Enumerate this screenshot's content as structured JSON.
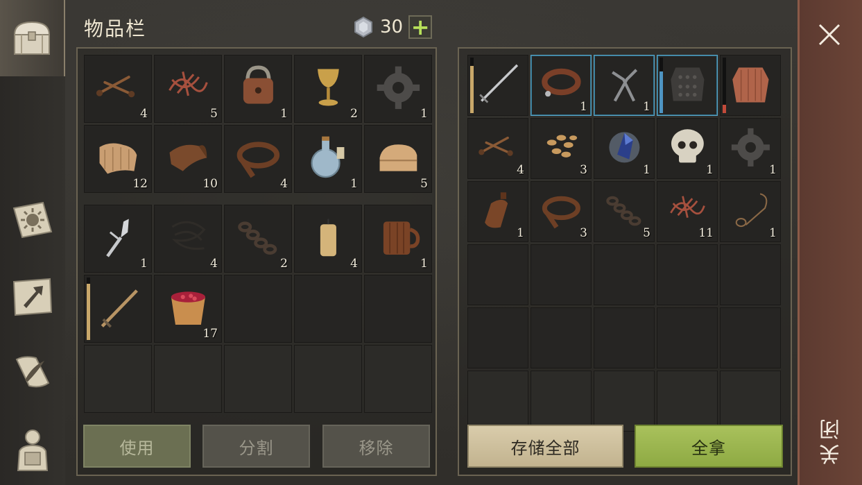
{
  "header": {
    "title": "物品栏",
    "currency_count": "30",
    "add_button_label": "+"
  },
  "sidebar": {
    "tabs": [
      {
        "name": "chest-icon",
        "active": true
      },
      {
        "name": "sun-map-icon",
        "active": false
      },
      {
        "name": "build-hammer-icon",
        "active": false
      },
      {
        "name": "quill-scroll-icon",
        "active": false
      },
      {
        "name": "character-backpack-icon",
        "active": false
      }
    ]
  },
  "inventory": {
    "top_grid": [
      {
        "item": "nails",
        "qty": "4"
      },
      {
        "item": "rope-fibers",
        "qty": "5"
      },
      {
        "item": "padlock",
        "qty": "1"
      },
      {
        "item": "golden-goblet",
        "qty": "2"
      },
      {
        "item": "gear",
        "qty": "1"
      },
      {
        "item": "cloth-scrap",
        "qty": "12"
      },
      {
        "item": "leather-piece",
        "qty": "10"
      },
      {
        "item": "leather-strap",
        "qty": "4"
      },
      {
        "item": "potion-bottle",
        "qty": "1"
      },
      {
        "item": "folded-cloth",
        "qty": "5"
      }
    ],
    "bottom_grid": [
      {
        "item": "fork",
        "qty": "1"
      },
      {
        "item": "wire",
        "qty": "4"
      },
      {
        "item": "chain",
        "qty": "2"
      },
      {
        "item": "candle",
        "qty": "4"
      },
      {
        "item": "wooden-mug",
        "qty": "1"
      },
      {
        "item": "sword",
        "qty": ""
      },
      {
        "item": "berry-bucket",
        "qty": "17"
      },
      {
        "item": "",
        "qty": ""
      },
      {
        "item": "",
        "qty": ""
      },
      {
        "item": "",
        "qty": ""
      },
      {
        "item": "",
        "qty": ""
      },
      {
        "item": "",
        "qty": ""
      },
      {
        "item": "",
        "qty": ""
      },
      {
        "item": "",
        "qty": ""
      },
      {
        "item": "",
        "qty": ""
      }
    ],
    "buttons": {
      "use": "使用",
      "split": "分割",
      "remove": "移除"
    }
  },
  "container": {
    "grid": [
      {
        "item": "long-sword",
        "qty": ""
      },
      {
        "item": "leather-collar",
        "qty": "1",
        "highlight": true
      },
      {
        "item": "pliers",
        "qty": "1",
        "highlight": true
      },
      {
        "item": "chainmail-armor",
        "qty": "",
        "highlight": true
      },
      {
        "item": "padded-shirt",
        "qty": ""
      },
      {
        "item": "nails",
        "qty": "4"
      },
      {
        "item": "seeds",
        "qty": "3"
      },
      {
        "item": "crystal-shard",
        "qty": "1"
      },
      {
        "item": "skull",
        "qty": "1"
      },
      {
        "item": "gear",
        "qty": "1"
      },
      {
        "item": "clay-bottle",
        "qty": "1"
      },
      {
        "item": "leather-strap",
        "qty": "3"
      },
      {
        "item": "chain",
        "qty": "5"
      },
      {
        "item": "rope-fibers",
        "qty": "11"
      },
      {
        "item": "rope-loop",
        "qty": "1"
      }
    ],
    "empty_rows": 3,
    "buttons": {
      "store_all": "存储全部",
      "take_all": "全拿"
    }
  },
  "close": {
    "label": "关闭"
  },
  "durability": {
    "inventory_sword": 0.9,
    "container_long_sword": 0.85,
    "container_chainmail": 0.75,
    "container_padded_shirt": 0.15
  },
  "colors": {
    "durability_sword": "#c9a86a",
    "durability_chainmail": "#4e94c2",
    "durability_shirt": "#c24a3a"
  }
}
